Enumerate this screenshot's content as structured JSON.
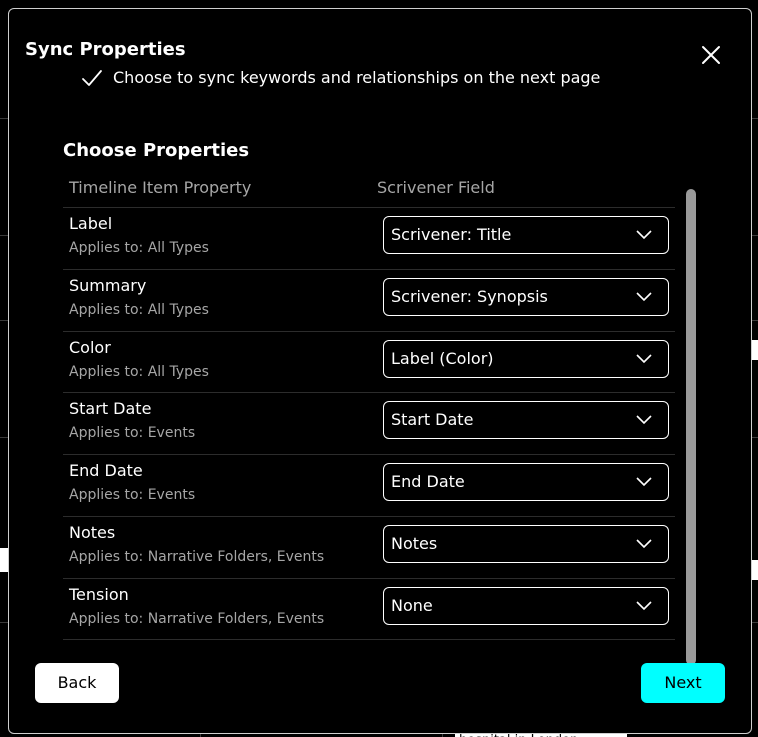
{
  "dialog": {
    "title": "Sync Properties",
    "sync_note": "Choose to sync keywords and relationships on the next page",
    "section_title": "Choose Properties",
    "columns": {
      "property": "Timeline Item Property",
      "field": "Scrivener Field"
    },
    "rows": [
      {
        "name": "Label",
        "applies": "Applies to: All Types",
        "value": "Scrivener: Title"
      },
      {
        "name": "Summary",
        "applies": "Applies to: All Types",
        "value": "Scrivener: Synopsis"
      },
      {
        "name": "Color",
        "applies": "Applies to: All Types",
        "value": "Label (Color)"
      },
      {
        "name": "Start Date",
        "applies": "Applies to: Events",
        "value": "Start Date"
      },
      {
        "name": "End Date",
        "applies": "Applies to: Events",
        "value": "End Date"
      },
      {
        "name": "Notes",
        "applies": "Applies to: Narrative Folders, Events",
        "value": "Notes"
      },
      {
        "name": "Tension",
        "applies": "Applies to: Narrative Folders, Events",
        "value": "None"
      }
    ],
    "back_label": "Back",
    "next_label": "Next"
  },
  "background": {
    "fragment_text": "hospital in London"
  },
  "icons": {
    "close": "close-icon",
    "check": "checkmark-icon",
    "chevron": "chevron-down-icon"
  },
  "colors": {
    "accent": "#00ffff",
    "background": "#000000",
    "muted_text": "#a6a6a6"
  }
}
